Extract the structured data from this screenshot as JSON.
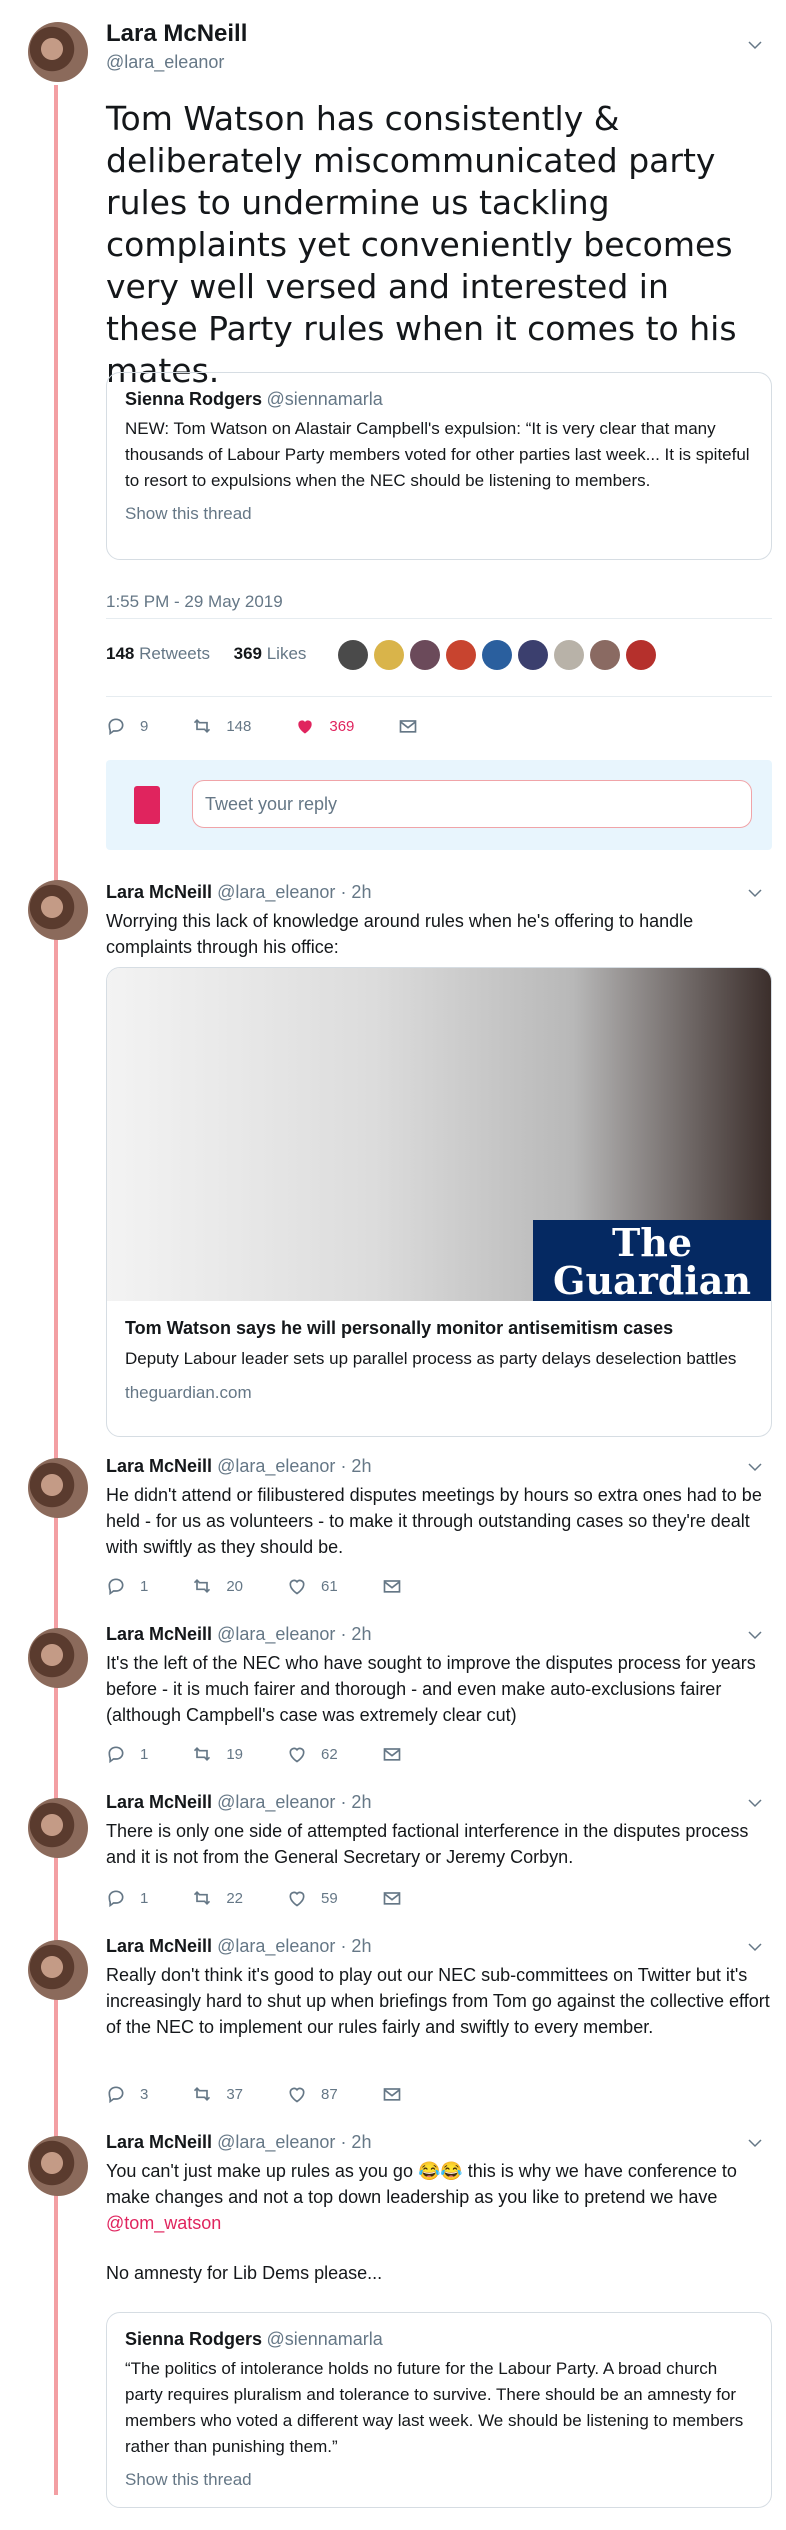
{
  "main_tweet": {
    "name": "Lara McNeill",
    "handle": "@lara_eleanor",
    "text": "Tom Watson has consistently & deliberately miscommunicated party rules to undermine us tackling complaints yet conveniently becomes very well versed and interested in these Party rules when it comes to his mates.",
    "quote": {
      "name": "Sienna Rodgers",
      "handle": "@siennamarla",
      "text": "NEW: Tom Watson on Alastair Campbell's expulsion: “It is very clear that many thousands of Labour Party members voted for other parties last week... It is spiteful to resort to expulsions when the NEC should be listening to members.",
      "link": "Show this thread"
    },
    "timestamp": "1:55 PM - 29 May 2019",
    "retweets": "148",
    "retweets_label": "Retweets",
    "likes": "369",
    "likes_label": "Likes",
    "actions": {
      "replies": "9",
      "retweets": "148",
      "likes": "369"
    }
  },
  "reply_box": {
    "placeholder": "Tweet your reply"
  },
  "replies": [
    {
      "name": "Lara McNeill",
      "handle": "@lara_eleanor",
      "time": "· 2h",
      "text": "Worrying this lack of knowledge around rules when he's offering to handle complaints through his office:",
      "card": {
        "logo_line1": "The",
        "logo_line2": "Guardian",
        "title": "Tom Watson says he will personally monitor antisemitism cases",
        "description": "Deputy Labour leader sets up parallel process as party delays deselection battles",
        "domain": "theguardian.com"
      }
    },
    {
      "name": "Lara McNeill",
      "handle": "@lara_eleanor",
      "time": "· 2h",
      "text": "He didn't attend or filibustered disputes meetings by hours so extra ones had to be held - for us as volunteers - to make it through outstanding cases so they're dealt with swiftly as they should be.",
      "actions": {
        "replies": "1",
        "retweets": "20",
        "likes": "61"
      }
    },
    {
      "name": "Lara McNeill",
      "handle": "@lara_eleanor",
      "time": "· 2h",
      "text": "It's the left of the NEC who have sought to improve the disputes process for years before - it is much fairer and thorough - and even make auto-exclusions fairer (although Campbell's case was extremely clear cut)",
      "actions": {
        "replies": "1",
        "retweets": "19",
        "likes": "62"
      }
    },
    {
      "name": "Lara McNeill",
      "handle": "@lara_eleanor",
      "time": "· 2h",
      "text": "There is only one side of attempted factional interference in the disputes process and it is not from the General Secretary or Jeremy Corbyn.",
      "actions": {
        "replies": "1",
        "retweets": "22",
        "likes": "59"
      }
    },
    {
      "name": "Lara McNeill",
      "handle": "@lara_eleanor",
      "time": "· 2h",
      "text": "Really don't think it's good to play out our NEC sub-committees on Twitter but it's increasingly hard to shut up when briefings from Tom go against the collective effort of the NEC to implement our rules fairly and swiftly to every member.",
      "actions": {
        "replies": "3",
        "retweets": "37",
        "likes": "87"
      }
    },
    {
      "name": "Lara McNeill",
      "handle": "@lara_eleanor",
      "time": "· 2h",
      "text_part1": "You can't just make up rules as you go 😂😂 this is why we have conference to make changes and not a top down leadership as you like to pretend we have",
      "mention": "@tom_watson",
      "text_part2": "No amnesty for Lib Dems please...",
      "quote": {
        "name": "Sienna Rodgers",
        "handle": "@siennamarla",
        "text": "“The politics of intolerance holds no future for the Labour Party. A broad church party requires pluralism and tolerance to survive. There should be an amnesty for members who voted a different way last week. We should be listening to members rather than punishing them.”",
        "link": "Show this thread"
      }
    }
  ],
  "colors": {
    "thread_line": "#f39fa3",
    "like": "#e0245e",
    "guardian_blue": "#052962",
    "muted": "#657786"
  }
}
